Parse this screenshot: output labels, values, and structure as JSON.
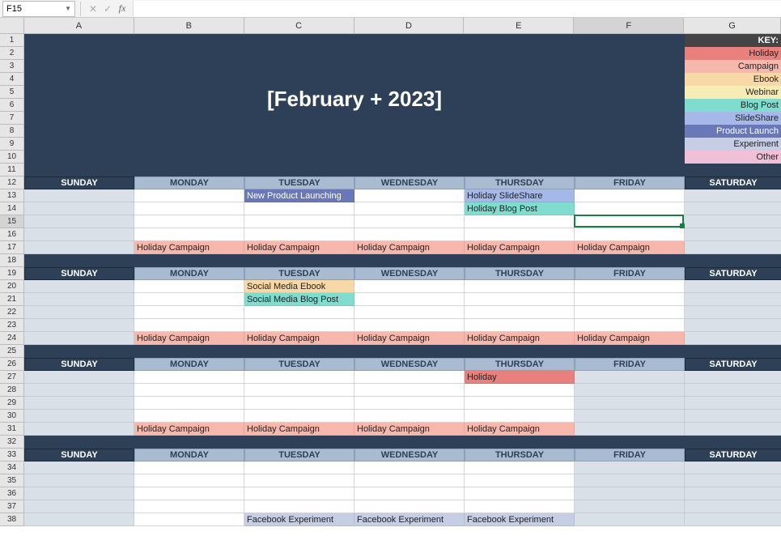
{
  "nameBox": "F15",
  "formula": "",
  "columns": [
    "A",
    "B",
    "C",
    "D",
    "E",
    "F",
    "G"
  ],
  "rowCount": 38,
  "selectedCol": "F",
  "selectedRow": 15,
  "title": "[February + 2023]",
  "key": {
    "header": "KEY:",
    "items": [
      {
        "label": "Holiday",
        "cls": "c-holiday"
      },
      {
        "label": "Campaign",
        "cls": "c-campaign"
      },
      {
        "label": "Ebook",
        "cls": "c-ebook"
      },
      {
        "label": "Webinar",
        "cls": "c-webinar"
      },
      {
        "label": "Blog Post",
        "cls": "c-blog"
      },
      {
        "label": "SlideShare",
        "cls": "c-slide"
      },
      {
        "label": "Product Launch",
        "cls": "c-launch"
      },
      {
        "label": "Experiment",
        "cls": "c-exper"
      },
      {
        "label": "Other",
        "cls": "c-other"
      }
    ]
  },
  "days": [
    "SUNDAY",
    "MONDAY",
    "TUESDAY",
    "WEDNESDAY",
    "THURSDAY",
    "FRIDAY",
    "SATURDAY"
  ],
  "weekHeaderRows": [
    12,
    19,
    26,
    33
  ],
  "gapRows": [
    11,
    18,
    25,
    32
  ],
  "entries": [
    {
      "row": 13,
      "cols": [
        "C"
      ],
      "cls": "c-launch",
      "text": "New Product Launching"
    },
    {
      "row": 13,
      "cols": [
        "E"
      ],
      "cls": "c-slide",
      "text": "Holiday SlideShare"
    },
    {
      "row": 14,
      "cols": [
        "E"
      ],
      "cls": "c-blog",
      "text": "Holiday Blog Post"
    },
    {
      "row": 17,
      "cols": [
        "B",
        "C",
        "D",
        "E",
        "F"
      ],
      "cls": "c-campaign",
      "text": "Holiday Campaign"
    },
    {
      "row": 20,
      "cols": [
        "C"
      ],
      "cls": "c-ebook",
      "text": "Social Media Ebook"
    },
    {
      "row": 21,
      "cols": [
        "C"
      ],
      "cls": "c-blog",
      "text": "Social Media Blog Post"
    },
    {
      "row": 24,
      "cols": [
        "B",
        "C",
        "D",
        "E",
        "F"
      ],
      "cls": "c-campaign",
      "text": "Holiday Campaign"
    },
    {
      "row": 27,
      "cols": [
        "E"
      ],
      "cls": "c-holiday",
      "text": "Holiday"
    },
    {
      "row": 31,
      "cols": [
        "B",
        "C",
        "D",
        "E"
      ],
      "cls": "c-campaign",
      "text": "Holiday Campaign"
    },
    {
      "row": 38,
      "cols": [
        "C",
        "D",
        "E"
      ],
      "cls": "c-exper",
      "text": "Facebook Experiment"
    }
  ]
}
